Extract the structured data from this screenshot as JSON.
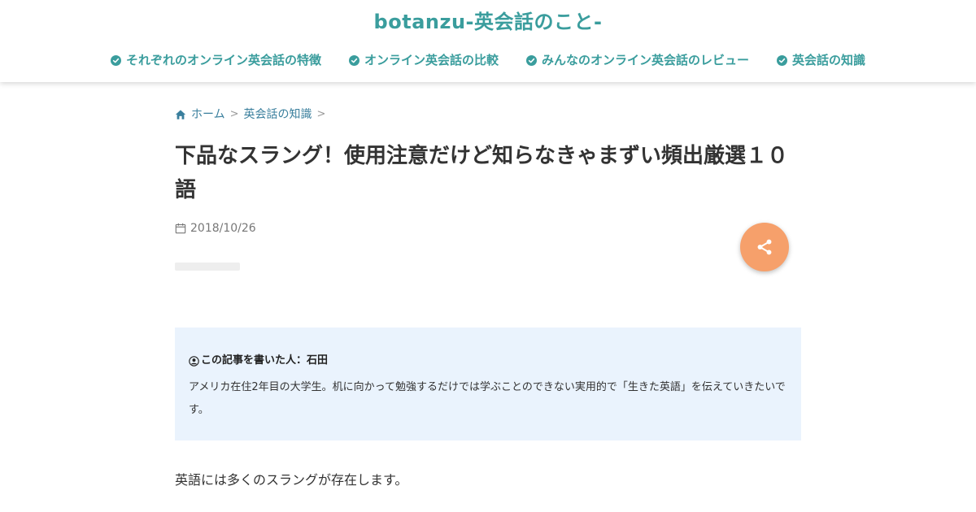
{
  "site": {
    "title": "botanzu-英会話のこと-",
    "accent_color": "#3a9d9d"
  },
  "nav": {
    "items": [
      {
        "label": "それぞれのオンライン英会話の特徴",
        "icon": "check-circle-icon"
      },
      {
        "label": "オンライン英会話の比較",
        "icon": "check-circle-icon"
      },
      {
        "label": "みんなのオンライン英会話のレビュー",
        "icon": "check-circle-icon"
      },
      {
        "label": "英会話の知識",
        "icon": "check-circle-icon"
      }
    ]
  },
  "breadcrumb": {
    "home": "ホーム",
    "category": "英会話の知識",
    "separator": ">"
  },
  "article": {
    "title": "下品なスラング！使用注意だけど知らなきゃまずい頻出厳選１０語",
    "date": "2018/10/26",
    "author_heading": "この記事を書いた人：石田",
    "author_description": "アメリカ在住2年目の大学生。机に向かって勉強するだけでは学ぶことのできない実用的で「生きた英語」を伝えていきたいです。",
    "intro": "英語には多くのスラングが存在します。"
  },
  "share": {
    "icon": "share-icon",
    "color": "#f6a06b"
  },
  "author_box_color": "#eaf3fd"
}
